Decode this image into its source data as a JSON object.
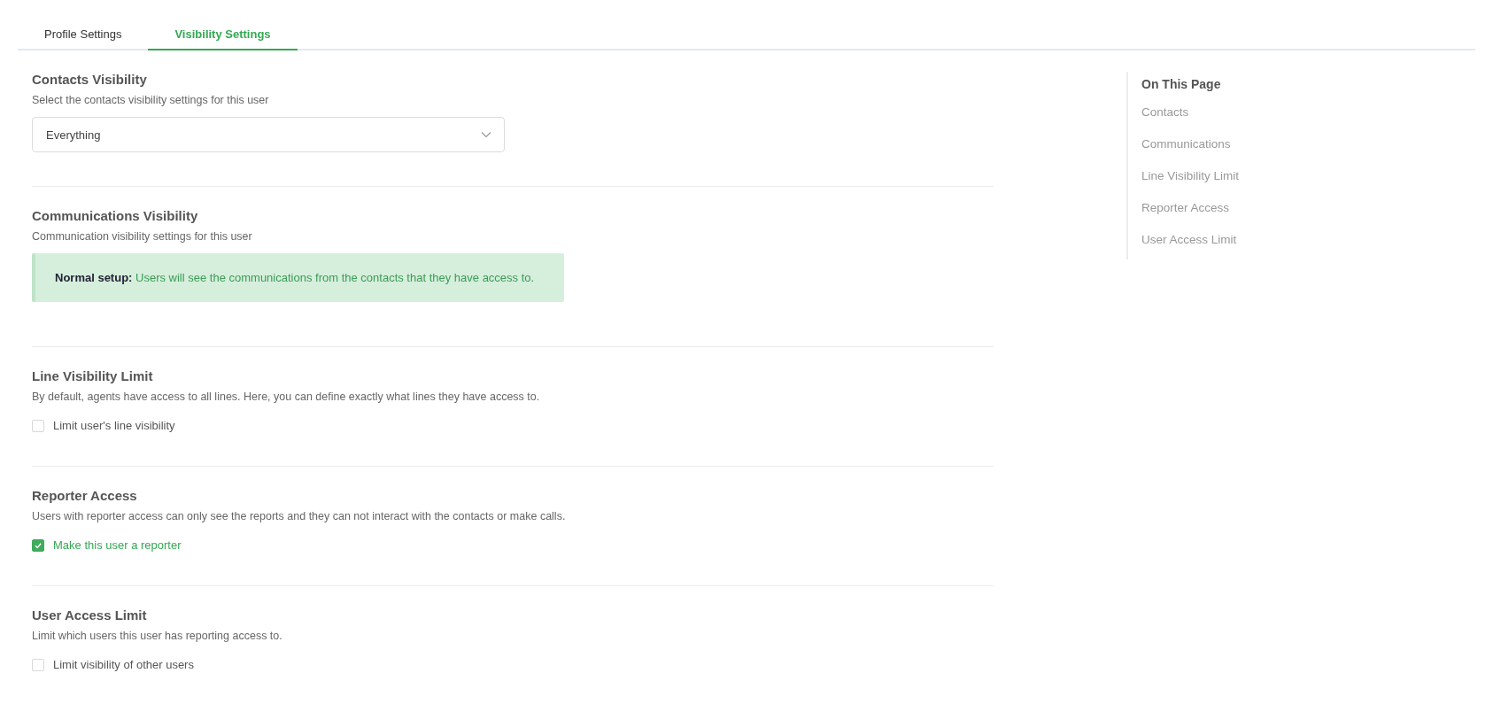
{
  "tabs": [
    {
      "label": "Profile Settings",
      "selected": false
    },
    {
      "label": "Visibility Settings",
      "selected": true
    }
  ],
  "sections": [
    {
      "kind": "select",
      "title": "Contacts Visibility",
      "description": "Select the contacts visibility settings for this user",
      "value": "Everything"
    },
    {
      "kind": "alert",
      "title": "Communications Visibility",
      "description": "Communication visibility settings for this user",
      "message": "**Normal setup:** Users will see the communications from the contacts that they have access to."
    },
    {
      "kind": "checkbox",
      "title": "Line Visibility Limit",
      "description": "By default, agents have access to all lines. Here, you can define exactly what lines they have access to.",
      "label": "Limit user's line visibility",
      "checked": false
    },
    {
      "kind": "checkbox",
      "title": "Reporter Access",
      "description": "Users with reporter access can only see the reports and they can not interact with the contacts or make calls.",
      "label": "Make this user a reporter",
      "checked": true
    },
    {
      "kind": "checkbox",
      "title": "User Access Limit",
      "description": "Limit which users this user has reporting access to.",
      "label": "Limit visibility of other users",
      "checked": false
    }
  ],
  "on_this_page": {
    "title": "On This Page",
    "items": [
      "Contacts",
      "Communications",
      "Line Visibility Limit",
      "Reporter Access",
      "User Access Limit"
    ]
  }
}
